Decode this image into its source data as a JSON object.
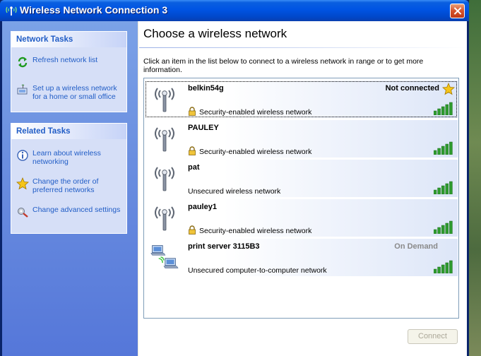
{
  "window": {
    "title": "Wireless Network Connection 3"
  },
  "sidebar": {
    "network_tasks": {
      "header": "Network Tasks",
      "items": [
        {
          "label": "Refresh network list",
          "icon": "refresh-icon"
        },
        {
          "label": "Set up a wireless network for a home or small office",
          "icon": "setup-network-icon"
        }
      ]
    },
    "related_tasks": {
      "header": "Related Tasks",
      "items": [
        {
          "label": "Learn about wireless networking",
          "icon": "info-icon"
        },
        {
          "label": "Change the order of preferred networks",
          "icon": "star-icon"
        },
        {
          "label": "Change advanced settings",
          "icon": "settings-icon"
        }
      ]
    }
  },
  "main": {
    "heading": "Choose a wireless network",
    "instructions": "Click an item in the list below to connect to a wireless network in range or to get more information.",
    "networks": [
      {
        "name": "belkin54g",
        "status": "Not connected",
        "security": "Security-enabled wireless network",
        "secured": true,
        "preferred": true,
        "signal": 5,
        "type": "antenna"
      },
      {
        "name": "PAULEY",
        "status": "",
        "security": "Security-enabled wireless network",
        "secured": true,
        "preferred": false,
        "signal": 5,
        "type": "antenna"
      },
      {
        "name": "pat",
        "status": "",
        "security": "Unsecured wireless network",
        "secured": false,
        "preferred": false,
        "signal": 5,
        "type": "antenna"
      },
      {
        "name": "pauley1",
        "status": "",
        "security": "Security-enabled wireless network",
        "secured": true,
        "preferred": false,
        "signal": 5,
        "type": "antenna"
      },
      {
        "name": "print server 3115B3",
        "status": "On Demand",
        "security": "Unsecured computer-to-computer network",
        "secured": false,
        "preferred": false,
        "signal": 5,
        "type": "adhoc"
      }
    ],
    "connect_label": "Connect"
  },
  "colors": {
    "link": "#215dc6",
    "title_bar": "#0054e3",
    "signal": "#2e9b2e"
  }
}
